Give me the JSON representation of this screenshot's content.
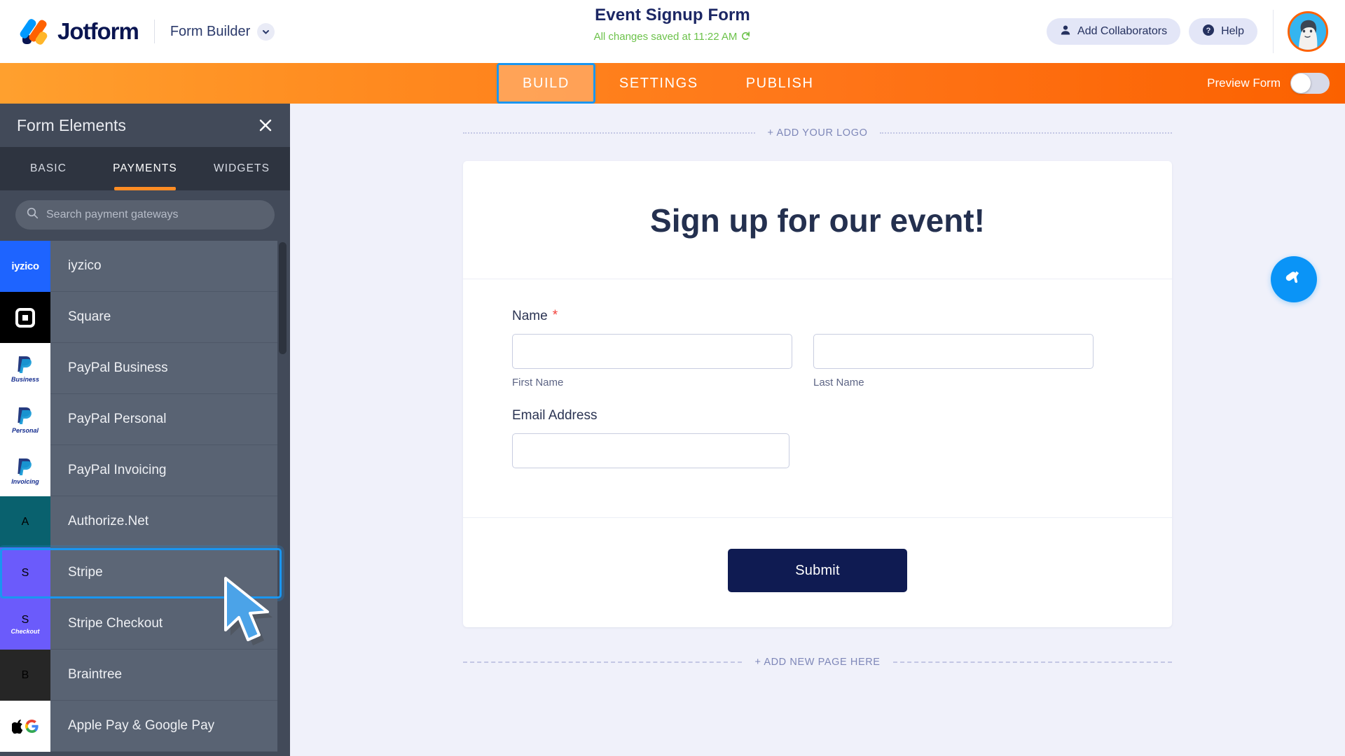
{
  "header": {
    "brand_name": "Jotform",
    "builder_label": "Form Builder",
    "form_title": "Event Signup Form",
    "save_status": "All changes saved at 11:22 AM",
    "add_collaborators_label": "Add Collaborators",
    "help_label": "Help"
  },
  "navbar": {
    "tabs": [
      {
        "label": "BUILD",
        "active": true
      },
      {
        "label": "SETTINGS",
        "active": false
      },
      {
        "label": "PUBLISH",
        "active": false
      }
    ],
    "preview_label": "Preview Form",
    "preview_toggle_on": false,
    "accent_color": "#ff7518",
    "focus_color": "#1a96f0"
  },
  "panel": {
    "title": "Form Elements",
    "tabs": [
      {
        "label": "BASIC",
        "active": false
      },
      {
        "label": "PAYMENTS",
        "active": true
      },
      {
        "label": "WIDGETS",
        "active": false
      }
    ],
    "search": {
      "value": "",
      "placeholder": "Search payment gateways"
    },
    "gateways": [
      {
        "name": "iyzico",
        "logo_text": "iyzico",
        "logo_sub": "",
        "bg": "#1e64ff",
        "fg": "#ffffff",
        "selected": false
      },
      {
        "name": "Square",
        "logo_text": "square",
        "logo_sub": "",
        "bg": "#000000",
        "fg": "#ffffff",
        "selected": false
      },
      {
        "name": "PayPal Business",
        "logo_text": "paypal",
        "logo_sub": "Business",
        "bg": "#ffffff",
        "fg": "#142c8e",
        "selected": false
      },
      {
        "name": "PayPal Personal",
        "logo_text": "paypal",
        "logo_sub": "Personal",
        "bg": "#ffffff",
        "fg": "#142c8e",
        "selected": false
      },
      {
        "name": "PayPal Invoicing",
        "logo_text": "paypal",
        "logo_sub": "Invoicing",
        "bg": "#ffffff",
        "fg": "#142c8e",
        "selected": false
      },
      {
        "name": "Authorize.Net",
        "logo_text": "A",
        "logo_sub": "",
        "bg": "#09616e",
        "fg": "#ffffff",
        "selected": false
      },
      {
        "name": "Stripe",
        "logo_text": "S",
        "logo_sub": "",
        "bg": "#6b5bfb",
        "fg": "#ffffff",
        "selected": true
      },
      {
        "name": "Stripe Checkout",
        "logo_text": "S",
        "logo_sub": "Checkout",
        "bg": "#6b5bfb",
        "fg": "#ffffff",
        "selected": false
      },
      {
        "name": "Braintree",
        "logo_text": "B",
        "logo_sub": "",
        "bg": "#262626",
        "fg": "#ffffff",
        "selected": false
      },
      {
        "name": "Apple Pay & Google Pay",
        "logo_text": "applegoogle",
        "logo_sub": "",
        "bg": "#ffffff",
        "fg": "#000000",
        "selected": false
      }
    ]
  },
  "canvas": {
    "add_logo_label": "+ ADD YOUR LOGO",
    "add_page_label": "+ ADD NEW PAGE HERE",
    "form": {
      "heading": "Sign up for our event!",
      "fields": [
        {
          "label": "Name",
          "required": true,
          "subfields": [
            {
              "sublabel": "First Name",
              "value": ""
            },
            {
              "sublabel": "Last Name",
              "value": ""
            }
          ]
        },
        {
          "label": "Email Address",
          "required": false,
          "subfields": [
            {
              "sublabel": "",
              "value": ""
            }
          ]
        }
      ],
      "submit_label": "Submit",
      "submit_color": "#0f1b52"
    }
  }
}
